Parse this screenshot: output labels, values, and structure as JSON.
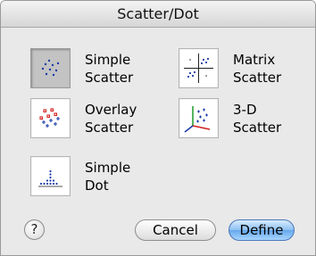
{
  "window": {
    "title": "Scatter/Dot"
  },
  "options": [
    {
      "line1": "Simple",
      "line2": "Scatter",
      "icon": "simple-scatter-icon",
      "selected": true
    },
    {
      "line1": "Matrix",
      "line2": "Scatter",
      "icon": "matrix-scatter-icon",
      "selected": false
    },
    {
      "line1": "Overlay",
      "line2": "Scatter",
      "icon": "overlay-scatter-icon",
      "selected": false
    },
    {
      "line1": "3-D",
      "line2": "Scatter",
      "icon": "3d-scatter-icon",
      "selected": false
    },
    {
      "line1": "Simple",
      "line2": "Dot",
      "icon": "simple-dot-icon",
      "selected": false
    }
  ],
  "buttons": {
    "help": "?",
    "cancel": "Cancel",
    "define": "Define"
  },
  "colors": {
    "default_button": "#7fb8f0",
    "icon_blue": "#1a3aa8",
    "icon_red": "#d42020",
    "icon_green": "#1a9a2a"
  }
}
